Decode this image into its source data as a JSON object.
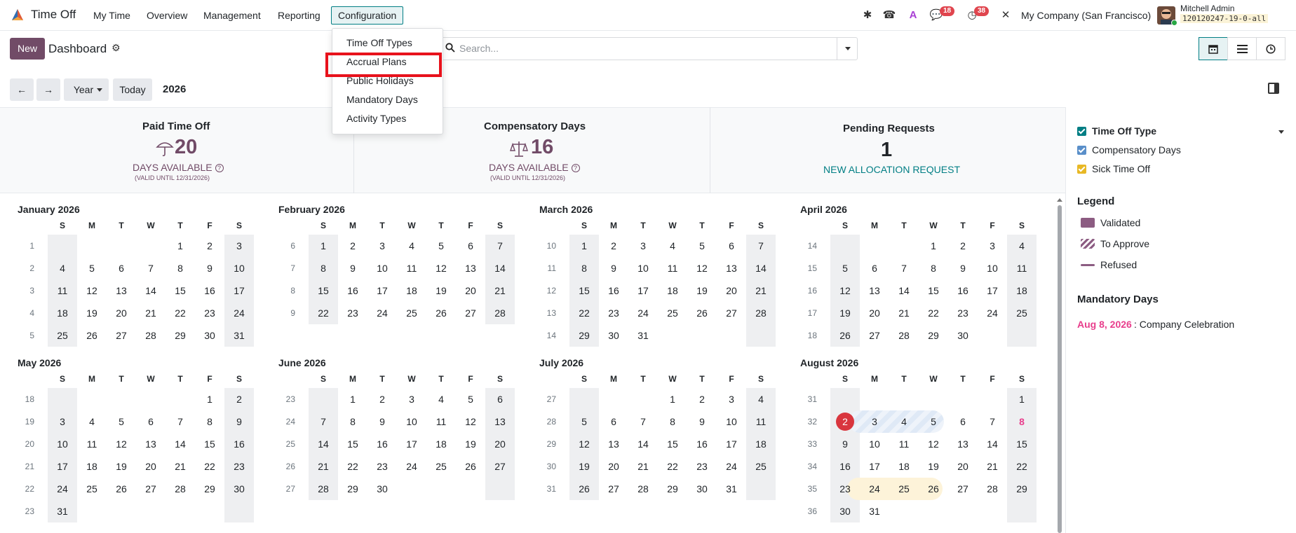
{
  "navbar": {
    "app_name": "Time Off",
    "menus": [
      "My Time",
      "Overview",
      "Management",
      "Reporting",
      "Configuration"
    ],
    "active_menu": "Configuration",
    "messages_badge": "18",
    "activities_badge": "38",
    "company": "My Company (San Francisco)",
    "user_name": "Mitchell Admin",
    "database": "120120247-19-0-all"
  },
  "control_panel": {
    "new_label": "New",
    "title": "Dashboard",
    "search_placeholder": "Search..."
  },
  "calendar_controls": {
    "scale_label": "Year",
    "today_label": "Today",
    "year": "2026"
  },
  "dropdown": {
    "items": [
      "Time Off Types",
      "Accrual Plans",
      "Public Holidays",
      "Mandatory Days",
      "Activity Types"
    ],
    "highlighted": "Accrual Plans"
  },
  "cards": {
    "paid": {
      "title": "Paid Time Off",
      "value": "20",
      "unit": "DAYS AVAILABLE",
      "valid": "(VALID UNTIL 12/31/2026)"
    },
    "comp": {
      "title": "Compensatory Days",
      "value": "16",
      "unit": "DAYS AVAILABLE",
      "valid": "(VALID UNTIL 12/31/2026)"
    },
    "pending": {
      "title": "Pending Requests",
      "value": "1",
      "link": "NEW ALLOCATION REQUEST"
    }
  },
  "weekdays": [
    "S",
    "M",
    "T",
    "W",
    "T",
    "F",
    "S"
  ],
  "months": [
    {
      "title": "January 2026",
      "start": 4,
      "days": 31,
      "week": 1
    },
    {
      "title": "February 2026",
      "start": 0,
      "days": 28,
      "week": 6
    },
    {
      "title": "March 2026",
      "start": 0,
      "days": 31,
      "week": 10
    },
    {
      "title": "April 2026",
      "start": 3,
      "days": 30,
      "week": 14
    },
    {
      "title": "May 2026",
      "start": 5,
      "days": 31,
      "week": 18
    },
    {
      "title": "June 2026",
      "start": 1,
      "days": 30,
      "week": 23
    },
    {
      "title": "July 2026",
      "start": 3,
      "days": 31,
      "week": 27
    },
    {
      "title": "August 2026",
      "start": 6,
      "days": 31,
      "week": 31
    }
  ],
  "august_marks": {
    "today": 2,
    "pending_range": [
      3,
      5
    ],
    "yellow_range": [
      24,
      26
    ],
    "mandatory_day": 8
  },
  "right_panel": {
    "filter_title": "Time Off Type",
    "filters": [
      {
        "label": "Compensatory Days",
        "color": "#5a8fc9"
      },
      {
        "label": "Sick Time Off",
        "color": "#e8b825"
      }
    ],
    "filter_title_color": "#017e84",
    "legend_title": "Legend",
    "legend": [
      "Validated",
      "To Approve",
      "Refused"
    ],
    "mandatory_title": "Mandatory Days",
    "mandatory_date": "Aug 8, 2026",
    "mandatory_name": ": Company Celebration"
  },
  "colors": {
    "brand": "#714b67",
    "teal": "#017e84",
    "danger": "#d9363e",
    "mandatory": "#e83e8c"
  }
}
